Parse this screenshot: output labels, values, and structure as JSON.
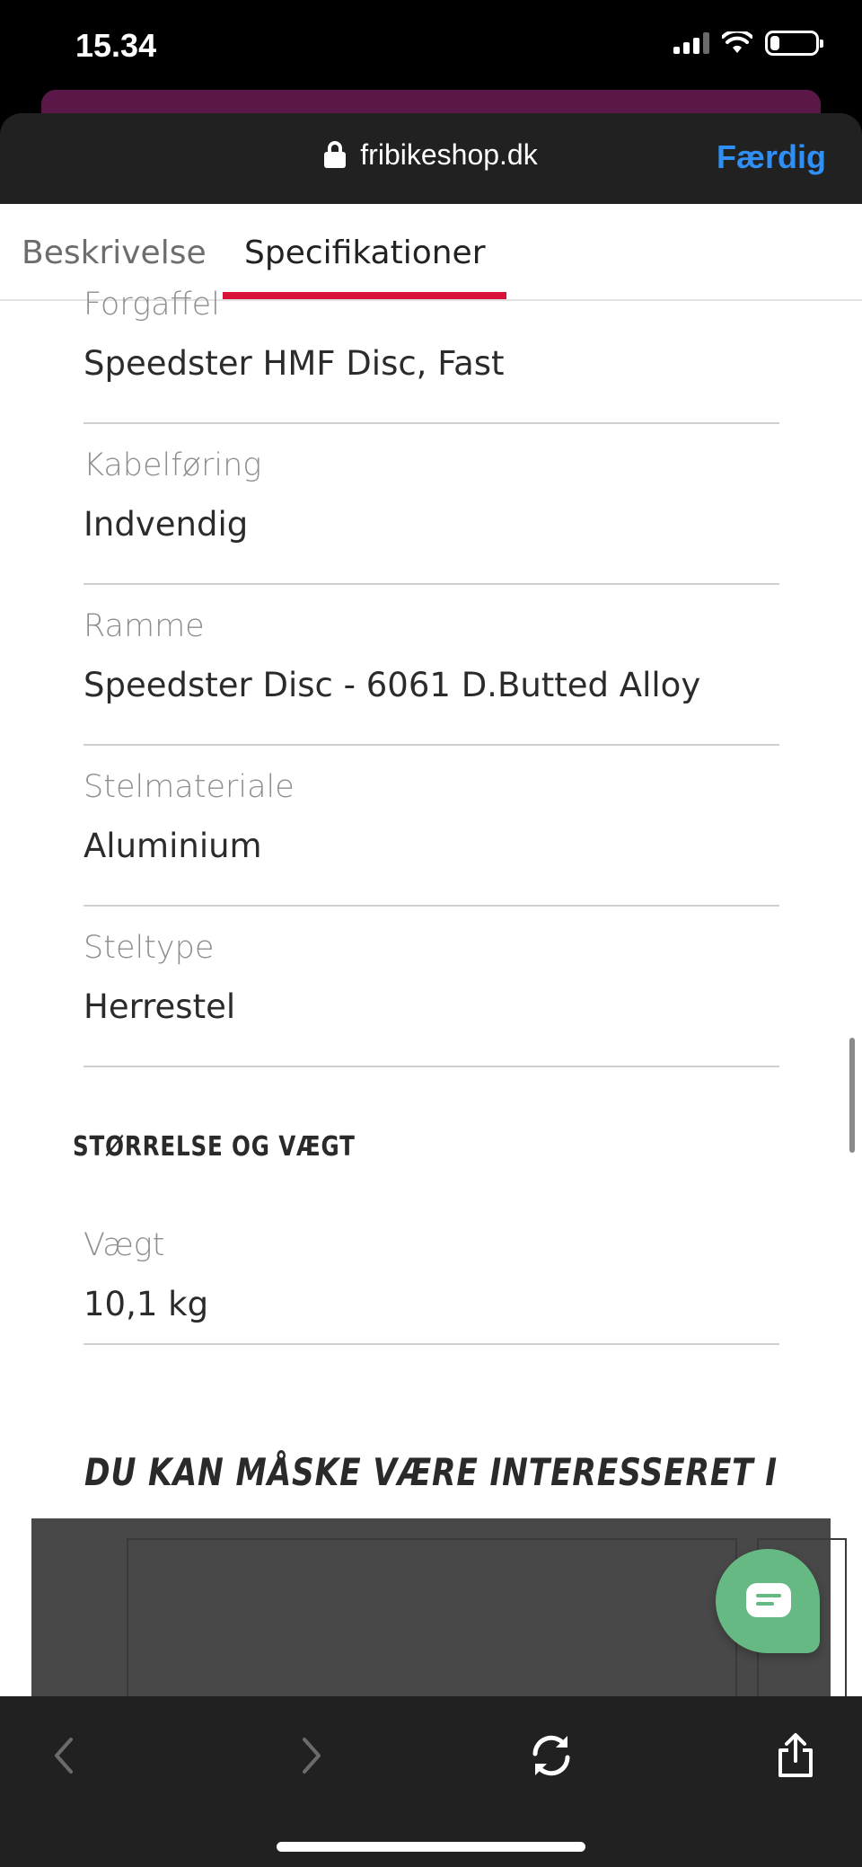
{
  "status_bar": {
    "time": "15.34",
    "signal_bars_active": 3,
    "signal_bars_total": 4,
    "battery_level": 0.2
  },
  "browser": {
    "url": "fribikeshop.dk",
    "done_label": "Færdig",
    "accent_color": "#2f8ff5"
  },
  "tabs": {
    "items": [
      {
        "label": "Beskrivelse",
        "active": false
      },
      {
        "label": "Specifikationer",
        "active": true
      }
    ],
    "active_color": "#d9123a"
  },
  "specs": [
    {
      "label": "Forgaffel",
      "value": "Speedster HMF Disc, Fast"
    },
    {
      "label": "Kabelføring",
      "value": "Indvendig"
    },
    {
      "label": "Ramme",
      "value": "Speedster Disc - 6061 D.Butted Alloy"
    },
    {
      "label": "Stelmateriale",
      "value": "Aluminium"
    },
    {
      "label": "Steltype",
      "value": "Herrestel"
    }
  ],
  "size_section": {
    "heading": "STØRRELSE OG VÆGT",
    "items": [
      {
        "label": "Vægt",
        "value": "10,1 kg"
      }
    ]
  },
  "recommendations": {
    "heading": "DU KAN MÅSKE VÆRE INTERESSERET I"
  },
  "chat": {
    "icon": "chat-bubble-icon",
    "color": "#67b984"
  },
  "toolbar": {
    "back_icon": "chevron-left-icon",
    "forward_icon": "chevron-right-icon",
    "reload_icon": "reload-icon",
    "share_icon": "share-icon"
  }
}
